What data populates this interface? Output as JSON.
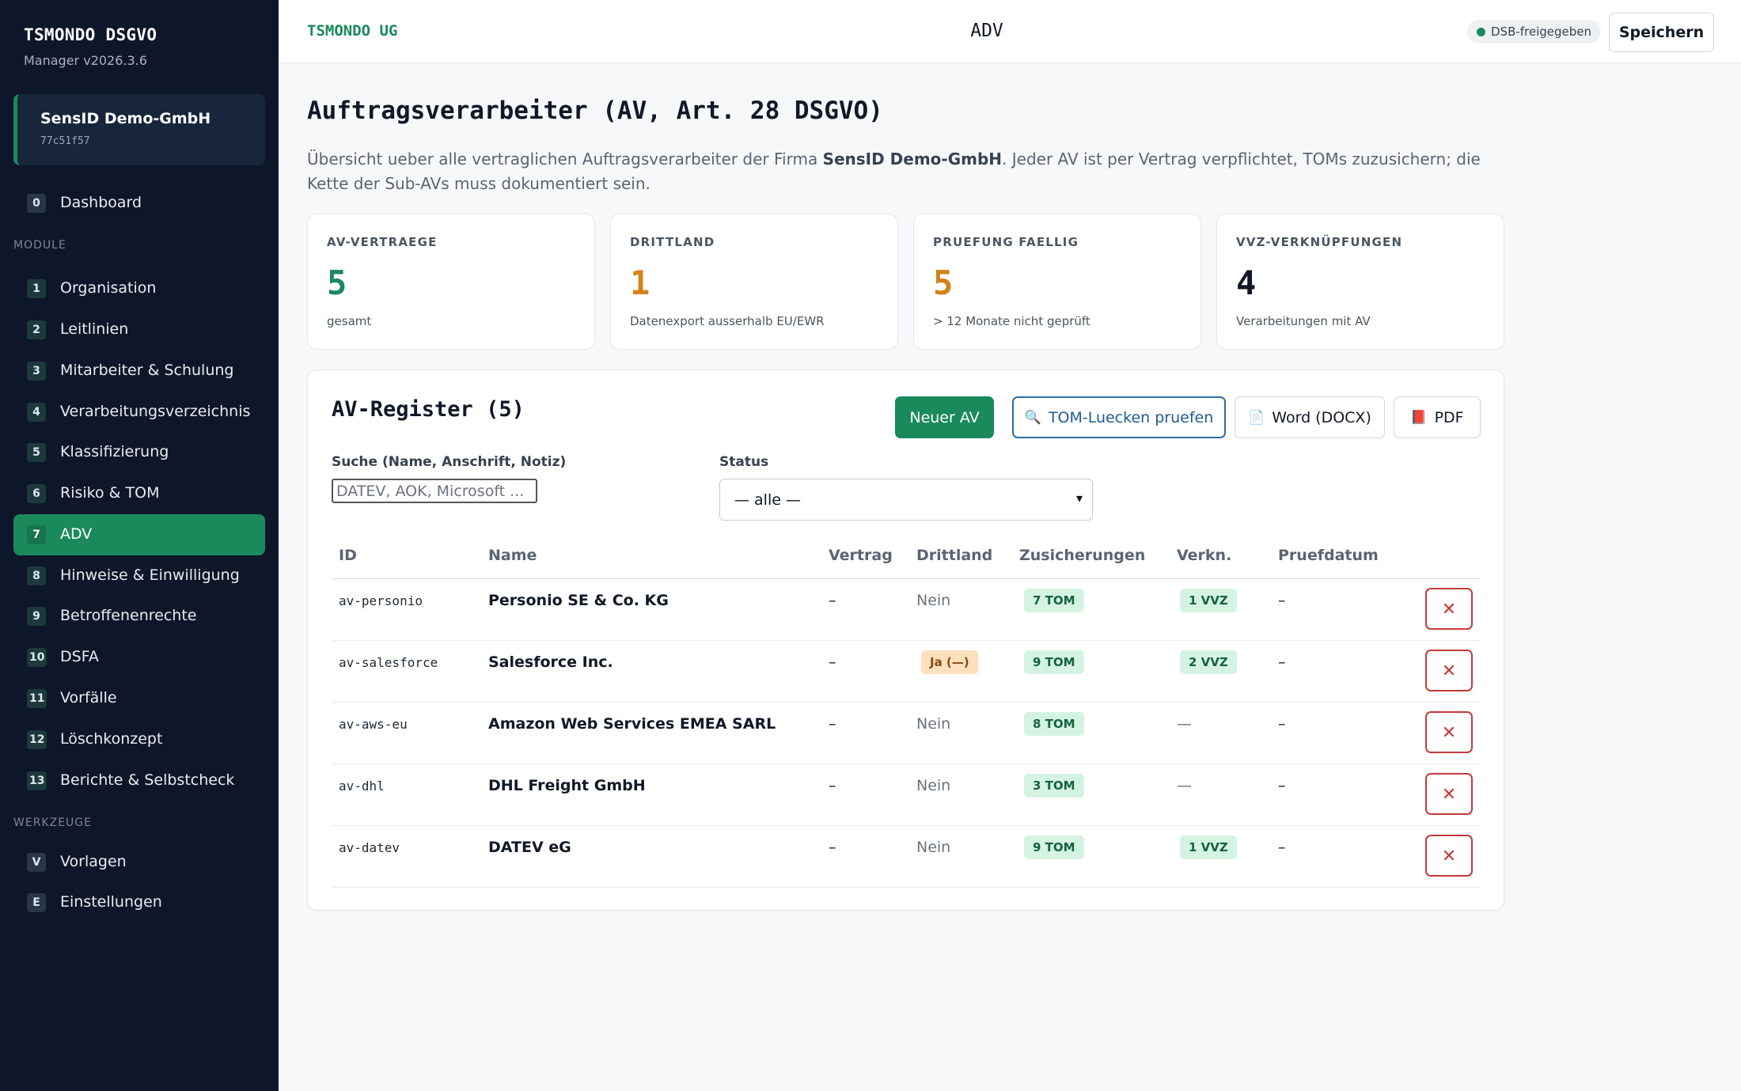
{
  "sidebar": {
    "brand": "TSMONDO DSGVO",
    "version": "Manager v2026.3.6",
    "org": {
      "name": "SensID Demo-GmbH",
      "id": "77c51f57"
    },
    "dashboard": {
      "num": "0",
      "label": "Dashboard"
    },
    "module_label": "MODULE",
    "modules": [
      {
        "num": "1",
        "label": "Organisation"
      },
      {
        "num": "2",
        "label": "Leitlinien"
      },
      {
        "num": "3",
        "label": "Mitarbeiter & Schulung"
      },
      {
        "num": "4",
        "label": "Verarbeitungsverzeichnis"
      },
      {
        "num": "5",
        "label": "Klassifizierung"
      },
      {
        "num": "6",
        "label": "Risiko & TOM"
      },
      {
        "num": "7",
        "label": "ADV"
      },
      {
        "num": "8",
        "label": "Hinweise & Einwilligung"
      },
      {
        "num": "9",
        "label": "Betroffenenrechte"
      },
      {
        "num": "10",
        "label": "DSFA"
      },
      {
        "num": "11",
        "label": "Vorfälle"
      },
      {
        "num": "12",
        "label": "Löschkonzept"
      },
      {
        "num": "13",
        "label": "Berichte & Selbstcheck"
      }
    ],
    "tools_label": "WERKZEUGE",
    "tools": [
      {
        "num": "V",
        "label": "Vorlagen"
      },
      {
        "num": "E",
        "label": "Einstellungen"
      }
    ]
  },
  "topbar": {
    "company": "TSMONDO UG",
    "title": "ADV",
    "badge": "DSB-freigegeben",
    "save_label": "Speichern"
  },
  "page": {
    "title": "Auftragsverarbeiter (AV, Art. 28 DSGVO)",
    "intro_before": "Übersicht ueber alle vertraglichen Auftragsverarbeiter der Firma ",
    "intro_company": "SensID Demo-GmbH",
    "intro_after": ". Jeder AV ist per Vertrag verpflichtet, TOMs zuzusichern; die Kette der Sub-AVs muss dokumentiert sein."
  },
  "stats": [
    {
      "label": "AV-VERTRAEGE",
      "value": "5",
      "sub": "gesamt",
      "color": "#1a8a5c"
    },
    {
      "label": "DRITTLAND",
      "value": "1",
      "sub": "Datenexport ausserhalb EU/EWR",
      "color": "#d4811a"
    },
    {
      "label": "PRUEFUNG FAELLIG",
      "value": "5",
      "sub": "> 12 Monate nicht geprüft",
      "color": "#d4811a"
    },
    {
      "label": "VVZ-VERKNÜPFUNGEN",
      "value": "4",
      "sub": "Verarbeitungen mit AV",
      "color": "#111827"
    }
  ],
  "register": {
    "title": "AV-Register (5)",
    "new_label": "Neuer AV",
    "tom_label": "TOM-Luecken pruefen",
    "word_label": "Word (DOCX)",
    "pdf_label": "PDF",
    "search_label": "Suche (Name, Anschrift, Notiz)",
    "search_placeholder": "DATEV, AOK, Microsoft ...",
    "status_label": "Status",
    "status_value": "— alle —",
    "columns": [
      "ID",
      "Name",
      "Vertrag",
      "Drittland",
      "Zusicherungen",
      "Verkn.",
      "Pruefdatum"
    ],
    "rows": [
      {
        "id": "av-personio",
        "name": "Personio SE & Co. KG",
        "vertrag": "–",
        "drittland": "Nein",
        "tom": "7 TOM",
        "vvz": "1 VVZ",
        "pruefdatum": "–"
      },
      {
        "id": "av-salesforce",
        "name": "Salesforce Inc.",
        "vertrag": "–",
        "drittland": "Ja (—)",
        "tom": "9 TOM",
        "vvz": "2 VVZ",
        "pruefdatum": "–"
      },
      {
        "id": "av-aws-eu",
        "name": "Amazon Web Services EMEA SARL",
        "vertrag": "–",
        "drittland": "Nein",
        "tom": "8 TOM",
        "vvz": "—",
        "pruefdatum": "–"
      },
      {
        "id": "av-dhl",
        "name": "DHL Freight GmbH",
        "vertrag": "–",
        "drittland": "Nein",
        "tom": "3 TOM",
        "vvz": "—",
        "pruefdatum": "–"
      },
      {
        "id": "av-datev",
        "name": "DATEV eG",
        "vertrag": "–",
        "drittland": "Nein",
        "tom": "9 TOM",
        "vvz": "1 VVZ",
        "pruefdatum": "–"
      }
    ]
  }
}
